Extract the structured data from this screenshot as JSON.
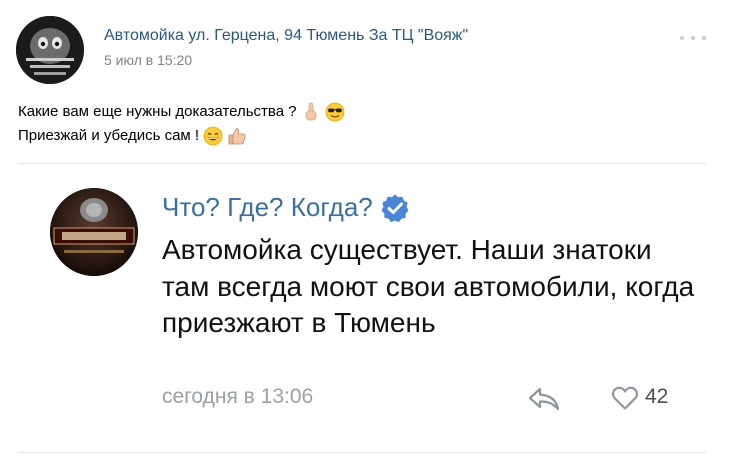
{
  "post": {
    "author": "Автомойка ул. Герцена, 94 Тюмень За ТЦ \"Вояж\"",
    "date": "5 июл в 15:20",
    "lines": [
      "Какие вам еще нужны доказательства ?",
      "Приезжай и убедись сам !"
    ],
    "emoji": [
      "index-finger-up",
      "sunglasses-face",
      "grinning-face",
      "thumbs-up"
    ]
  },
  "screenshot": {
    "channel_name": "Что? Где? Когда?",
    "verified_badge": "verified-check-icon",
    "text": "Автомойка существует. Наши знатоки там всегда моют свои автомобили, когда приезжают в Тюмень",
    "time": "сегодня в 13:06",
    "like_count": "42"
  },
  "colors": {
    "link_blue": "#2a5885",
    "muted_gray": "#828282",
    "verified_blue": "#4a86d8"
  }
}
